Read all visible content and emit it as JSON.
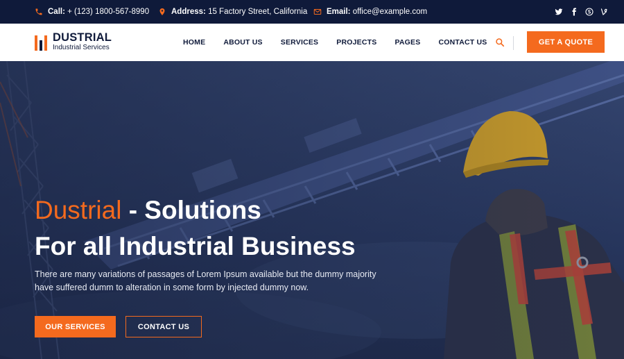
{
  "topbar": {
    "call": {
      "label": "Call:",
      "value": "+ (123) 1800-567-8990",
      "icon": "phone-icon"
    },
    "address": {
      "label": "Address:",
      "value": "15 Factory Street, California",
      "icon": "map-pin-icon"
    },
    "email": {
      "label": "Email:",
      "value": "office@example.com",
      "icon": "envelope-icon"
    },
    "social": [
      {
        "name": "twitter-icon",
        "glyph": "t"
      },
      {
        "name": "facebook-icon",
        "glyph": "f"
      },
      {
        "name": "skype-icon",
        "glyph": "S"
      },
      {
        "name": "vine-icon",
        "glyph": "V"
      }
    ]
  },
  "brand": {
    "title": "DUSTRIAL",
    "subtitle": "Industrial Services"
  },
  "nav": {
    "items": [
      {
        "label": "HOME"
      },
      {
        "label": "ABOUT US"
      },
      {
        "label": "SERVICES"
      },
      {
        "label": "PROJECTS"
      },
      {
        "label": "PAGES"
      },
      {
        "label": "CONTACT US"
      }
    ],
    "quote_button": "GET A QUOTE"
  },
  "hero": {
    "title_accent": "Dustrial",
    "title_rest": " - Solutions",
    "title_line2": "For all Industrial Business",
    "description": "There are many variations of passages of Lorem Ipsum available but the dummy majority have suffered dumm to alteration in some form by injected dummy now.",
    "primary_button": "OUR SERVICES",
    "secondary_button": "CONTACT US"
  },
  "colors": {
    "accent": "#f46a1e",
    "navy": "#0f1a3a",
    "hero_overlay": "#243356"
  }
}
